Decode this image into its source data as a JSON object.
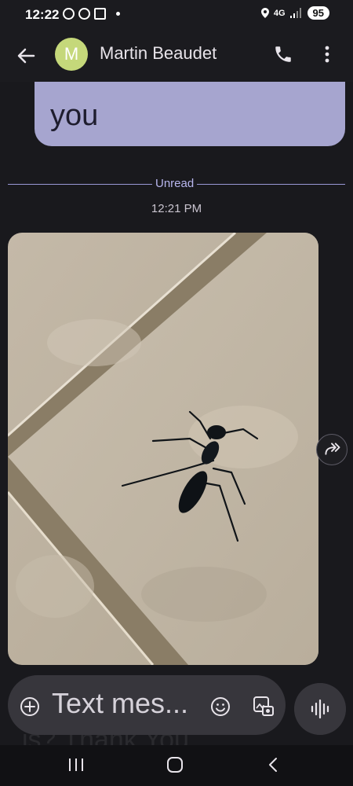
{
  "status_bar": {
    "time": "12:22",
    "network": "4G",
    "battery": "95"
  },
  "app_bar": {
    "avatar_initial": "M",
    "avatar_color": "#c5d87a",
    "contact_name": "Martin Beaudet"
  },
  "conversation": {
    "outgoing_bubble_text": "you",
    "outgoing_bubble_color": "#a6a5cf",
    "unread_divider_label": "Unread",
    "timestamp": "12:21 PM"
  },
  "compose": {
    "placeholder": "Text mes...",
    "ghost_text": "is? Thank You"
  },
  "icons": {
    "back": "arrow-left-icon",
    "call": "phone-icon",
    "more": "more-vert-icon",
    "forward": "forward-icon",
    "add": "add-circle-icon",
    "emoji": "emoji-icon",
    "gallery": "gallery-icon",
    "voice": "voice-wave-icon"
  }
}
